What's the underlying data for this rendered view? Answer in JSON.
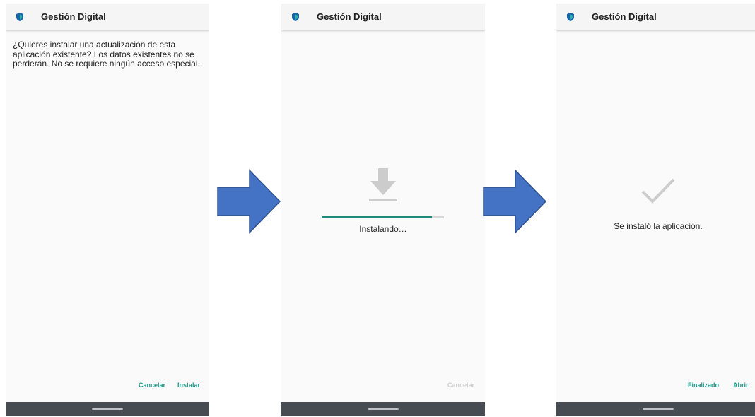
{
  "colors": {
    "accent": "#1a9a86",
    "progress_fill": "#1f8a7a",
    "nav_bar": "#474c52",
    "arrow_fill": "#4472c4",
    "arrow_stroke": "#2f528f",
    "icon_gray": "#cccccc"
  },
  "icons": {
    "app": "shield-icon",
    "download": "download-icon",
    "done": "checkmark-icon",
    "flow": "arrow-right-icon"
  },
  "screens": [
    {
      "app_title": "Gestión Digital",
      "message": "¿Quieres instalar una actualización de esta aplicación existente? Los datos existentes no se perderán. No se requiere ningún acceso especial.",
      "buttons": {
        "cancel": "Cancelar",
        "install": "Instalar"
      }
    },
    {
      "app_title": "Gestión Digital",
      "status": "Instalando…",
      "progress": 0.9,
      "buttons": {
        "cancel": "Cancelar"
      }
    },
    {
      "app_title": "Gestión Digital",
      "status": "Se instaló la aplicación.",
      "buttons": {
        "done": "Finalizado",
        "open": "Abrir"
      }
    }
  ]
}
